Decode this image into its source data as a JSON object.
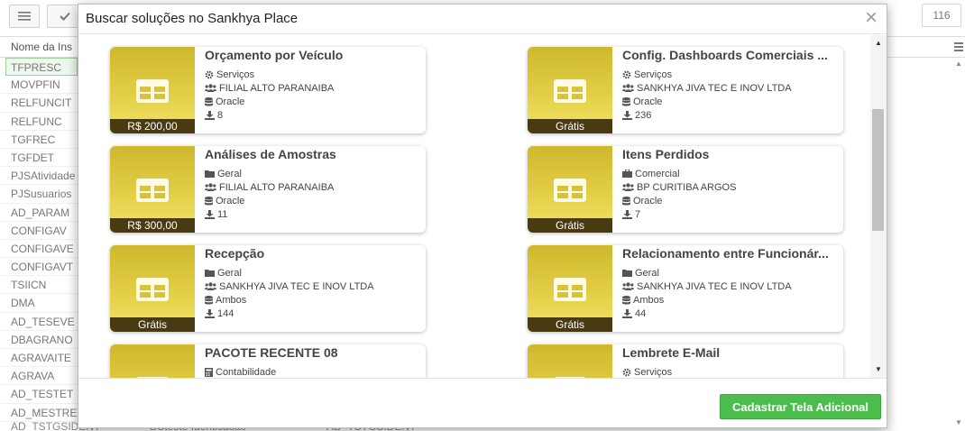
{
  "background": {
    "list_count": "116",
    "column_header": "Nome da Ins",
    "rows": [
      "TFPRESC",
      "MOVPFIN",
      "RELFUNCIT",
      "RELFUNC",
      "TGFREC",
      "TGFDET",
      "PJSAtividade",
      "PJSusuarios",
      "AD_PARAM",
      "CONFIGAV",
      "CONFIGAVE",
      "CONFIGAVT",
      "TSIICN",
      "DMA",
      "AD_TESEVE",
      "DBAGRANO",
      "AGRAVAITE",
      "AGRAVA",
      "AD_TESTET",
      "AD_MESTRE"
    ],
    "bottom_row": [
      "AD_TSTGSIDENT",
      "GSteste Identicacao",
      "AD_TSTGSIDENT"
    ]
  },
  "modal": {
    "title": "Buscar soluções no Sankhya Place",
    "close_label": "×",
    "footer_button": "Cadastrar Tela Adicional"
  },
  "cards": [
    {
      "title": "Orçamento por Veículo",
      "category": "Serviços",
      "category_icon": "gear-icon",
      "company": "FILIAL ALTO PARANAIBA",
      "database": "Oracle",
      "downloads": "8",
      "price": "R$ 200,00"
    },
    {
      "title": "Config. Dashboards Comerciais ...",
      "category": "Serviços",
      "category_icon": "gear-icon",
      "company": "SANKHYA JIVA TEC E INOV LTDA",
      "database": "Oracle",
      "downloads": "236",
      "price": "Grátis"
    },
    {
      "title": "Análises de Amostras",
      "category": "Geral",
      "category_icon": "folder-icon",
      "company": "FILIAL ALTO PARANAIBA",
      "database": "Oracle",
      "downloads": "11",
      "price": "R$ 300,00"
    },
    {
      "title": "Itens Perdidos",
      "category": "Comercial",
      "category_icon": "briefcase-icon",
      "company": "BP CURITIBA ARGOS",
      "database": "Oracle",
      "downloads": "7",
      "price": "Grátis"
    },
    {
      "title": "Recepção",
      "category": "Geral",
      "category_icon": "folder-icon",
      "company": "SANKHYA JIVA TEC E INOV LTDA",
      "database": "Ambos",
      "downloads": "144",
      "price": "Grátis"
    },
    {
      "title": "Relacionamento entre Funcionár...",
      "category": "Geral",
      "category_icon": "folder-icon",
      "company": "SANKHYA JIVA TEC E INOV LTDA",
      "database": "Ambos",
      "downloads": "44",
      "price": "Grátis"
    },
    {
      "title": "PACOTE RECENTE 08",
      "category": "Contabilidade",
      "category_icon": "calculator-icon",
      "company": "",
      "database": "",
      "downloads": "",
      "price": ""
    },
    {
      "title": "Lembrete E-Mail",
      "category": "Serviços",
      "category_icon": "gear-icon",
      "company": "",
      "database": "",
      "downloads": "",
      "price": ""
    }
  ]
}
